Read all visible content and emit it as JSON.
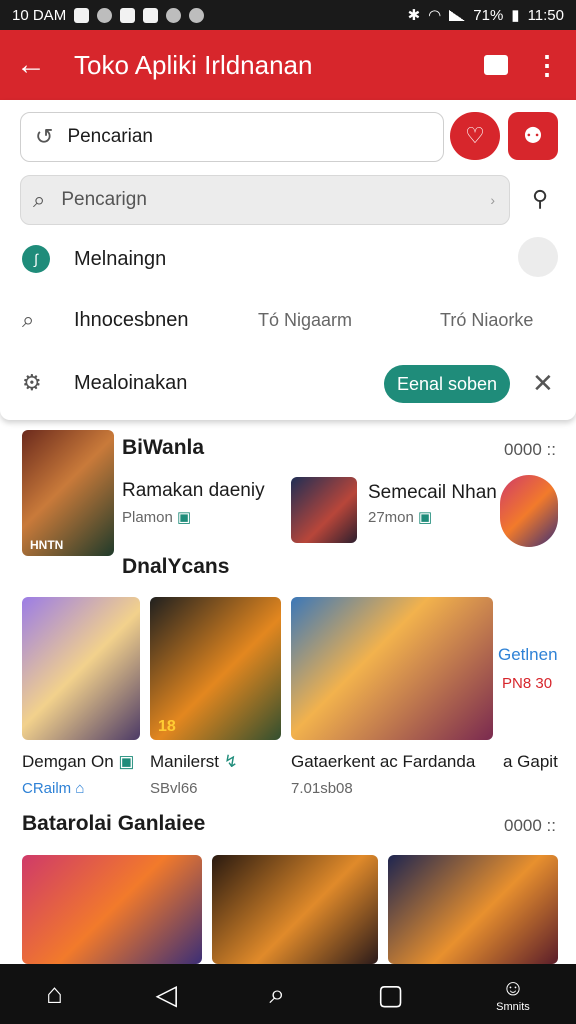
{
  "status": {
    "time_left": "10 DAM",
    "battery": "71%",
    "clock": "11:50"
  },
  "appbar": {
    "title": "Toko Apliki Irldnanan"
  },
  "search_top": {
    "value": "Pencarian"
  },
  "search_box": {
    "placeholder": "Pencarign"
  },
  "suggestions": {
    "first": "Melnaingn",
    "second": "Ihnocesbnen",
    "second_tag_a": "Tó Nigaarm",
    "second_tag_b": "Tró Niaorke",
    "third": "Mealoinakan",
    "pill": "Eenal soben"
  },
  "featured": {
    "title": "BiWanla",
    "more": "0000 ::",
    "left_app": {
      "name": "Ramakan daeniy",
      "sub": "Plamon"
    },
    "right_app": {
      "name": "Semecail Nhan",
      "sub": "27mon"
    },
    "thumb_label": "HNTN"
  },
  "section2": {
    "title": "DnalYcans",
    "cards": [
      {
        "name": "Demgan On",
        "sub": "CRailm"
      },
      {
        "name": "Manilerst",
        "sub": "SBvl66"
      },
      {
        "name": "Gataerkent ac Fardanda",
        "sub": "7.01sb08"
      },
      {
        "name": "a Gapit",
        "sub": ""
      }
    ],
    "side_title": "Getlnen",
    "side_sub": "PN8 30",
    "badge_1": "18"
  },
  "section3": {
    "title": "Batarolai Ganlaiee",
    "more": "0000 ::"
  },
  "navbar": {
    "profile_label": "Smnits"
  },
  "colors": {
    "accent": "#d7262c",
    "teal": "#1f8c7a",
    "link": "#2f82d6"
  }
}
